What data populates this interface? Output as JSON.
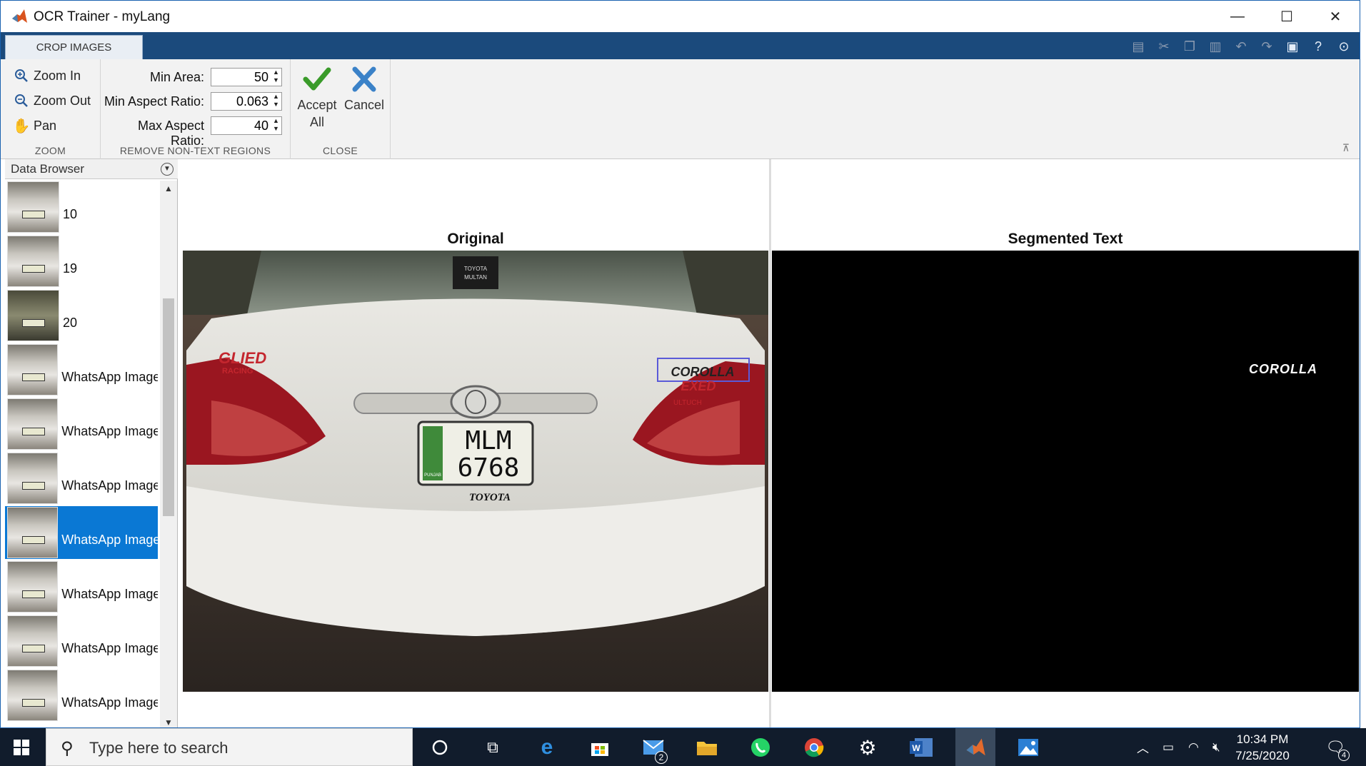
{
  "window": {
    "title": "OCR Trainer - myLang",
    "controls": {
      "minimize": "—",
      "maximize": "☐",
      "close": "✕"
    }
  },
  "ribbon": {
    "active_tab": "CROP IMAGES",
    "zoom_group": {
      "label": "ZOOM",
      "zoom_in": "Zoom In",
      "zoom_out": "Zoom Out",
      "pan": "Pan"
    },
    "remove_group": {
      "label": "REMOVE NON-TEXT REGIONS",
      "min_area_label": "Min Area:",
      "min_area_value": "50",
      "min_aspect_label": "Min Aspect Ratio:",
      "min_aspect_value": "0.063",
      "max_aspect_label": "Max Aspect Ratio:",
      "max_aspect_value": "40"
    },
    "close_group": {
      "label": "CLOSE",
      "accept_line1": "Accept",
      "accept_line2": "All",
      "cancel": "Cancel"
    }
  },
  "data_browser": {
    "title": "Data Browser",
    "items": [
      {
        "label": "10"
      },
      {
        "label": "19"
      },
      {
        "label": "20"
      },
      {
        "label": "WhatsApp Image"
      },
      {
        "label": "WhatsApp Image"
      },
      {
        "label": "WhatsApp Image"
      },
      {
        "label": "WhatsApp Image",
        "selected": true
      },
      {
        "label": "WhatsApp Image"
      },
      {
        "label": "WhatsApp Image"
      },
      {
        "label": "WhatsApp Image"
      }
    ]
  },
  "panes": {
    "original_title": "Original",
    "segmented_title": "Segmented Text",
    "segmented_word": "COROLLA"
  },
  "photo": {
    "brand_badge": "GLIED",
    "racing": "RACING",
    "model_badge": "COROLLA",
    "trim_badge": "EXED",
    "small_badge": "ULTUCH",
    "plate_line1": "MLM",
    "plate_line2": "6768",
    "plate_region": "PUNJAB",
    "plate_brand": "TOYOTA",
    "sticker_line1": "TOYOTA",
    "sticker_line2": "MULTAN"
  },
  "taskbar": {
    "search_placeholder": "Type here to search",
    "mail_badge": "2",
    "time": "10:34 PM",
    "date": "7/25/2020",
    "notification_count": "4"
  },
  "colors": {
    "ribbon_tab_bar": "#1b4a7c",
    "selection": "#0a78d4",
    "taskbar": "#111c2c"
  }
}
